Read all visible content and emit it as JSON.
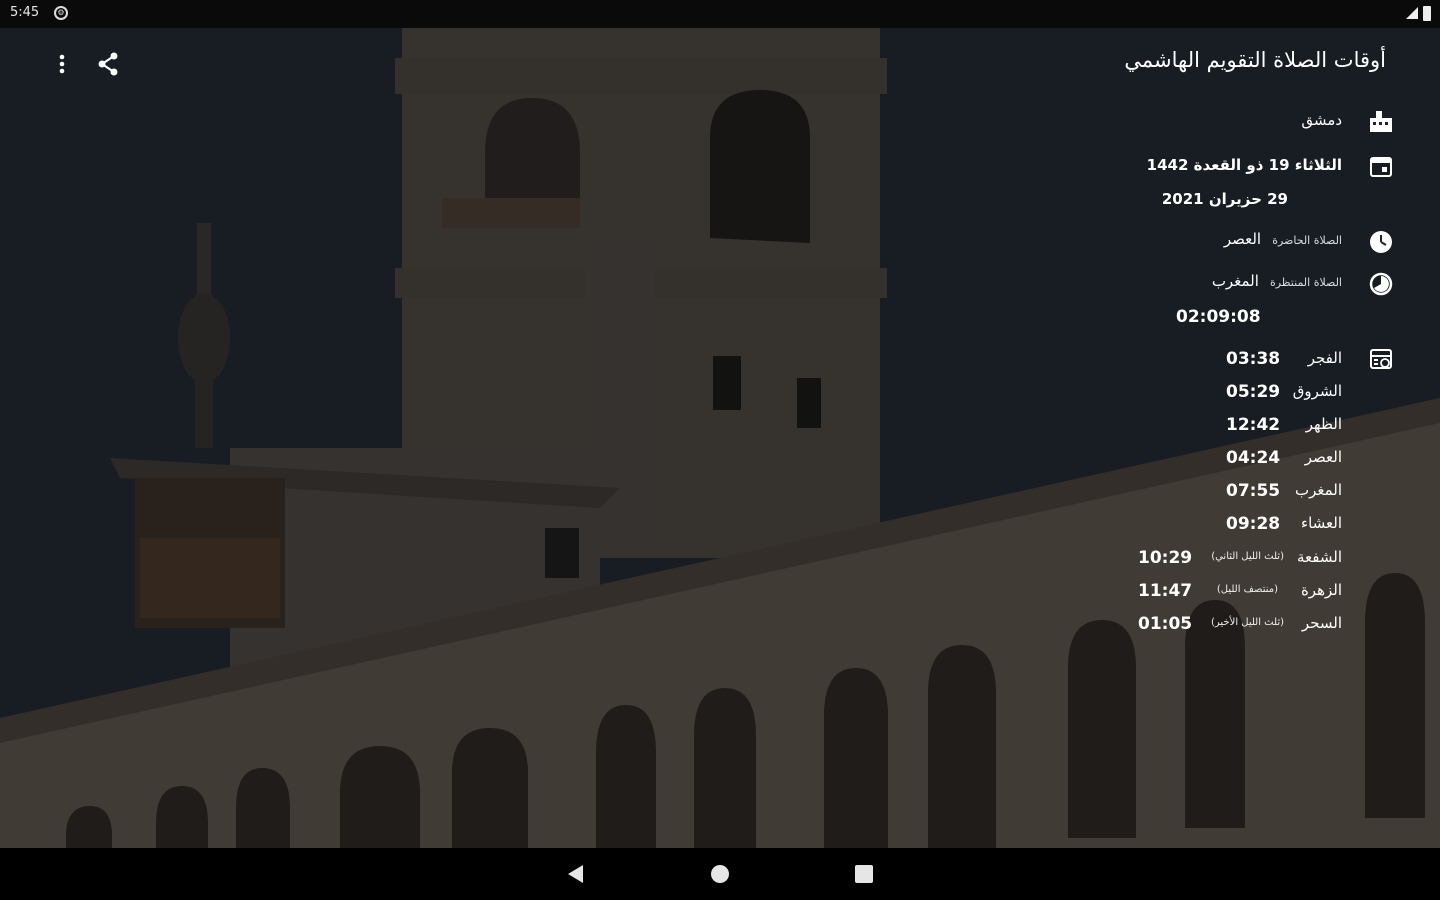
{
  "status_bar": {
    "time": "5:45",
    "app_icon": "settings-icon"
  },
  "toolbar": {
    "title": "أوقات الصلاة التقويم الهاشمي",
    "more_icon": "more-vert-icon",
    "share_icon": "share-icon"
  },
  "info": {
    "city": "دمشق",
    "hijri_date": "الثلاثاء 19 ذو القعدة 1442",
    "gregorian_date": "29 حزيران 2021",
    "current_prayer_label": "الصلاة الحاضرة",
    "current_prayer": "العصر",
    "next_prayer_label": "الصلاة المنتظرة",
    "next_prayer": "المغرب",
    "countdown": "02:09:08"
  },
  "prayers": [
    {
      "name": "الفجر",
      "time": "03:38",
      "note": ""
    },
    {
      "name": "الشروق",
      "time": "05:29",
      "note": ""
    },
    {
      "name": "الظهر",
      "time": "12:42",
      "note": ""
    },
    {
      "name": "العصر",
      "time": "04:24",
      "note": ""
    },
    {
      "name": "المغرب",
      "time": "07:55",
      "note": ""
    },
    {
      "name": "العشاء",
      "time": "09:28",
      "note": ""
    },
    {
      "name": "الشفعة",
      "time": "10:29",
      "note": "(ثلث الليل الثاني)"
    },
    {
      "name": "الزهرة",
      "time": "11:47",
      "note": "(منتصف الليل)"
    },
    {
      "name": "السحر",
      "time": "01:05",
      "note": "(ثلث الليل الأخير)"
    }
  ],
  "colors": {
    "overlay": "#1d232b",
    "text": "#ffffff",
    "stone": "#5a5148"
  }
}
